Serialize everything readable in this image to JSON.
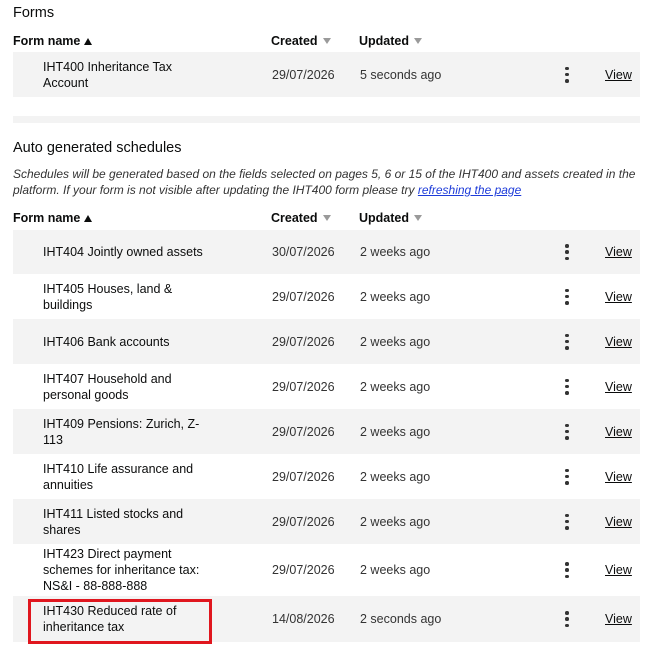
{
  "forms": {
    "title": "Forms",
    "columns": {
      "name": "Form name",
      "created": "Created",
      "updated": "Updated"
    },
    "rows": [
      {
        "name": "IHT400 Inheritance Tax Account",
        "created": "29/07/2026",
        "updated": "5 seconds ago",
        "action": "View"
      }
    ]
  },
  "schedules": {
    "title": "Auto generated schedules",
    "description": "Schedules will be generated based on the fields selected on pages 5, 6 or 15 of the IHT400 and assets created in the platform. If your form is not visible after updating the IHT400 form please try",
    "link": "refreshing the page",
    "columns": {
      "name": "Form name",
      "created": "Created",
      "updated": "Updated"
    },
    "rows": [
      {
        "name": "IHT404 Jointly owned assets",
        "created": "30/07/2026",
        "updated": "2 weeks ago",
        "action": "View"
      },
      {
        "name": "IHT405 Houses, land & buildings",
        "created": "29/07/2026",
        "updated": "2 weeks ago",
        "action": "View"
      },
      {
        "name": "IHT406 Bank accounts",
        "created": "29/07/2026",
        "updated": "2 weeks ago",
        "action": "View"
      },
      {
        "name": "IHT407 Household and personal goods",
        "created": "29/07/2026",
        "updated": "2 weeks ago",
        "action": "View"
      },
      {
        "name": "IHT409 Pensions: Zurich, Z-113",
        "created": "29/07/2026",
        "updated": "2 weeks ago",
        "action": "View"
      },
      {
        "name": "IHT410 Life assurance and annuities",
        "created": "29/07/2026",
        "updated": "2 weeks ago",
        "action": "View"
      },
      {
        "name": "IHT411 Listed stocks and shares",
        "created": "29/07/2026",
        "updated": "2 weeks ago",
        "action": "View"
      },
      {
        "name": "IHT423 Direct payment schemes for inheritance tax: NS&I - 88-888-888",
        "created": "29/07/2026",
        "updated": "2 weeks ago",
        "action": "View"
      },
      {
        "name": "IHT430 Reduced rate of inheritance tax",
        "created": "14/08/2026",
        "updated": "2 seconds ago",
        "action": "View"
      }
    ]
  },
  "icons": {
    "sort_asc": "sort-ascending-icon",
    "sort_desc": "sort-descending-icon",
    "row_menu": "kebab-menu-icon"
  },
  "colors": {
    "row_bg": "#f3f3f3",
    "link": "#1d3bd9",
    "highlight": "#e0161e"
  }
}
